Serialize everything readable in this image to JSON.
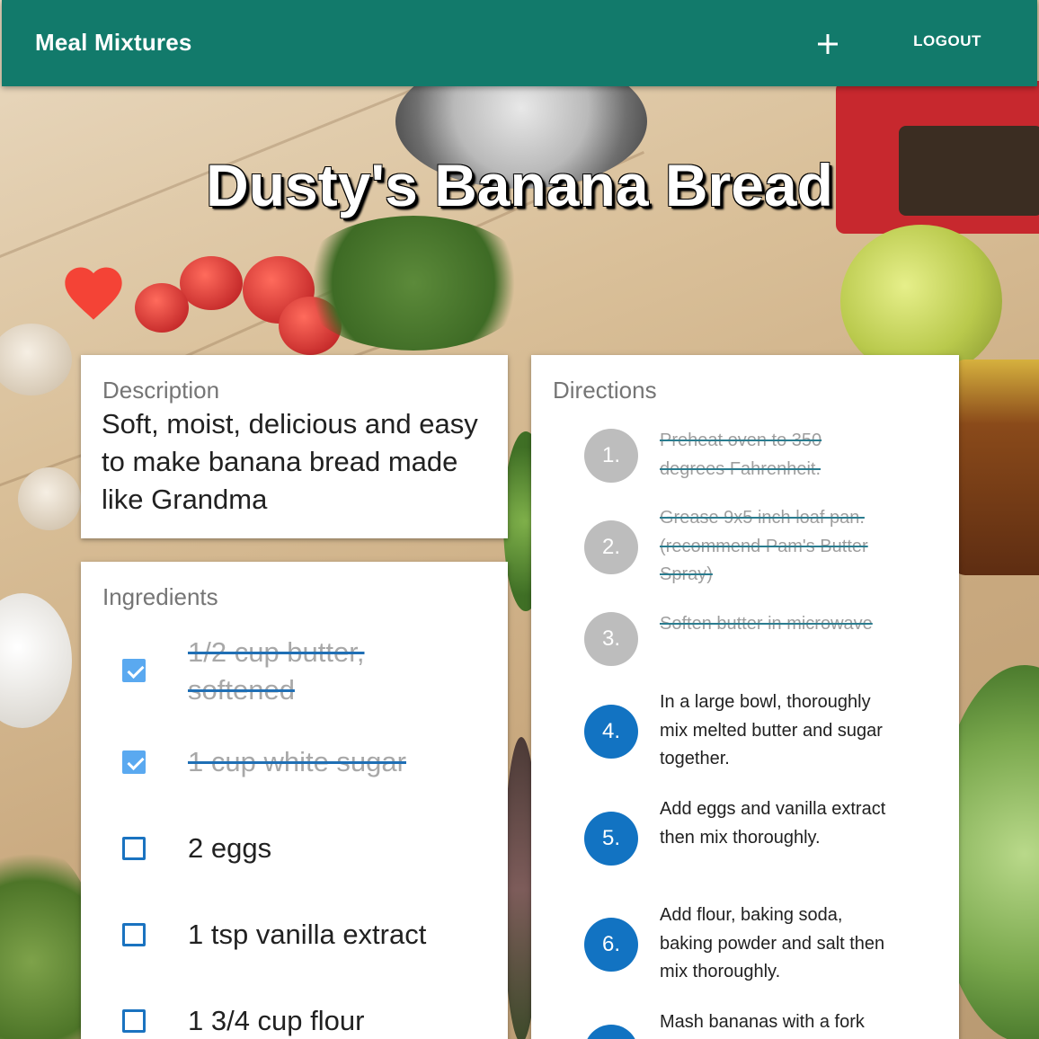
{
  "app": {
    "brand": "Meal Mixtures",
    "add_icon": "plus-icon",
    "logout_label": "LOGOUT"
  },
  "recipe": {
    "title": "Dusty's Banana Bread",
    "favorite": true,
    "favorite_icon": "heart-icon",
    "description_heading": "Description",
    "description": "Soft, moist, delicious and easy to make banana bread made like Grandma",
    "ingredients_heading": "Ingredients",
    "ingredients": [
      {
        "text": "1/2 cup butter, softened",
        "checked": true
      },
      {
        "text": "1 cup white sugar",
        "checked": true
      },
      {
        "text": "2 eggs",
        "checked": false
      },
      {
        "text": "1 tsp vanilla extract",
        "checked": false
      },
      {
        "text": "1 3/4 cup flour",
        "checked": false
      }
    ],
    "directions_heading": "Directions",
    "directions": [
      {
        "num": "1.",
        "text": "Preheat oven to 350 degrees Fahrenheit.",
        "done": true
      },
      {
        "num": "2.",
        "text": "Grease 9x5 inch loaf pan. (recommend Pam's Butter Spray)",
        "done": true
      },
      {
        "num": "3.",
        "text": "Soften butter in microwave",
        "done": true
      },
      {
        "num": "4.",
        "text": "In a large bowl, thoroughly mix melted butter and sugar together.",
        "done": false
      },
      {
        "num": "5.",
        "text": "Add eggs and vanilla extract then mix thoroughly.",
        "done": false
      },
      {
        "num": "6.",
        "text": "Add flour, baking soda, baking powder and salt then mix thoroughly.",
        "done": false
      },
      {
        "num": "",
        "text": "Mash bananas with a fork",
        "done": false
      }
    ]
  },
  "colors": {
    "appbar": "#127a6b",
    "heart": "#f44336",
    "step_done": "#bdbdbd",
    "step_todo": "#1273c2",
    "checkbox_checked": "#5aa9f0"
  }
}
